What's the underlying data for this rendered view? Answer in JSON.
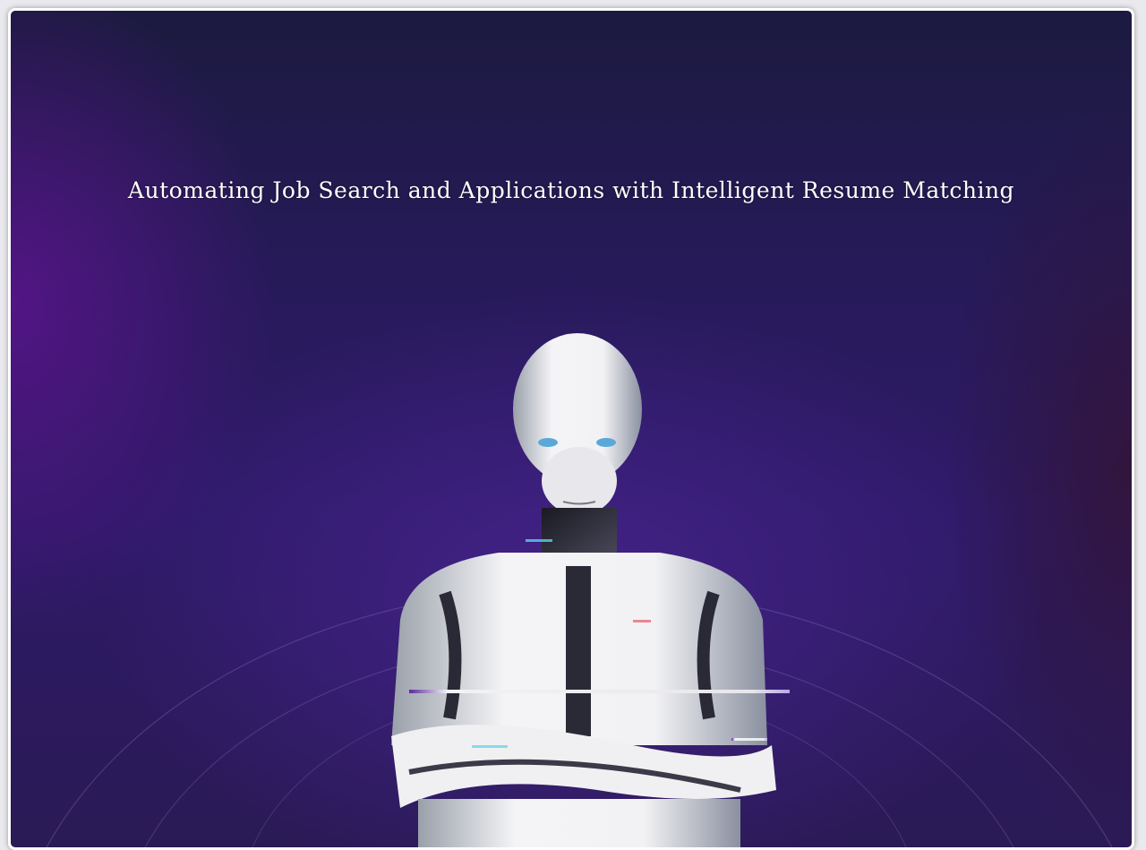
{
  "hero": {
    "title": "Automating Job Search and Applications with Intelligent Resume Matching"
  },
  "image": {
    "subject": "humanoid-robot-arms-crossed-icon",
    "colors": {
      "background_dark": "#1c1a40",
      "background_purple": "#2e1a68",
      "accent_violet": "#5a1a8c",
      "robot_white": "#eeeef0"
    }
  }
}
